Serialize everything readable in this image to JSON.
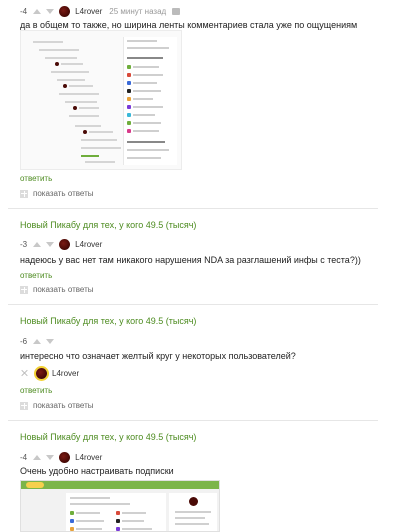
{
  "comments": [
    {
      "score": "-4",
      "user": "L4rover",
      "time": "25 минут назад",
      "text": "да в общем то также, но ширина ленты комментариев стала уже по ощущениям",
      "reply": "ответить",
      "show_replies": "показать ответы"
    },
    {
      "post_title": "Новый Пикабу для тех, у кого 49.5 (тысяч)",
      "score": "-3",
      "user": "L4rover",
      "text": "надеюсь у вас нет там никакого нарушения NDA за разглашений инфы с теста?))",
      "reply": "ответить",
      "show_replies": "показать ответы"
    },
    {
      "post_title": "Новый Пикабу для тех, у кого 49.5 (тысяч)",
      "score": "-6",
      "user": "L4rover",
      "text": "интересно что означает желтый круг у некоторых пользователей?",
      "reply": "ответить",
      "show_replies": "показать ответы"
    },
    {
      "post_title": "Новый Пикабу для тех, у кого 49.5 (тысяч)",
      "score": "-4",
      "user": "L4rover",
      "text": "Очень удобно настраивать подписки"
    }
  ],
  "colors": {
    "accent_green": "#4c8b1f",
    "avatar_ring": "#f3d234"
  }
}
